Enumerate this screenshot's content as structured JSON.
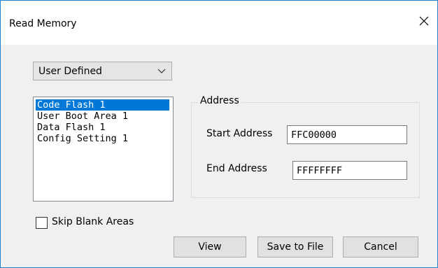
{
  "window": {
    "title": "Read Memory"
  },
  "dropdown": {
    "value": "User Defined"
  },
  "memory_areas": {
    "items": [
      {
        "label": "Code Flash 1",
        "selected": true
      },
      {
        "label": "User Boot Area 1",
        "selected": false
      },
      {
        "label": "Data Flash 1",
        "selected": false
      },
      {
        "label": "Config Setting 1",
        "selected": false
      }
    ]
  },
  "address": {
    "group_label": "Address",
    "start_label": "Start Address",
    "start_value": "FFC00000",
    "end_label": "End Address",
    "end_value": "FFFFFFFF"
  },
  "options": {
    "skip_blank_label": "Skip Blank Areas",
    "skip_blank_checked": false
  },
  "buttons": {
    "view": "View",
    "save": "Save to File",
    "cancel": "Cancel"
  },
  "colors": {
    "selection": "#0078d7",
    "window_border": "#1883d7",
    "face": "#f0f0f0"
  }
}
